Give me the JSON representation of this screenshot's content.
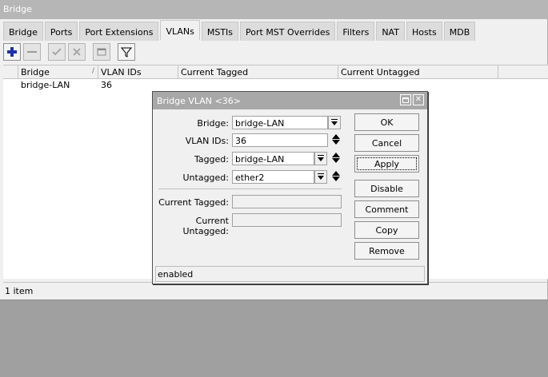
{
  "window": {
    "title": "Bridge"
  },
  "tabs": [
    {
      "label": "Bridge",
      "active": false
    },
    {
      "label": "Ports",
      "active": false
    },
    {
      "label": "Port Extensions",
      "active": false
    },
    {
      "label": "VLANs",
      "active": true
    },
    {
      "label": "MSTIs",
      "active": false
    },
    {
      "label": "Port MST Overrides",
      "active": false
    },
    {
      "label": "Filters",
      "active": false
    },
    {
      "label": "NAT",
      "active": false
    },
    {
      "label": "Hosts",
      "active": false
    },
    {
      "label": "MDB",
      "active": false
    }
  ],
  "toolbar": {
    "icons": [
      "add-icon",
      "remove-icon",
      "enable-icon",
      "disable-icon",
      "comment-icon",
      "filter-icon"
    ],
    "accent_color": "#1c2fb0"
  },
  "table": {
    "columns": [
      "",
      "Bridge",
      "VLAN IDs",
      "Current Tagged",
      "Current Untagged"
    ],
    "rows": [
      {
        "bridge": "bridge-LAN",
        "vlan_ids": "36",
        "current_tagged": "",
        "current_untagged": ""
      }
    ]
  },
  "status": {
    "item_count": "1 item"
  },
  "dialog": {
    "title": "Bridge VLAN <36>",
    "fields": {
      "bridge": {
        "label": "Bridge:",
        "value": "bridge-LAN"
      },
      "vlan_ids": {
        "label": "VLAN IDs:",
        "value": "36"
      },
      "tagged": {
        "label": "Tagged:",
        "value": "bridge-LAN"
      },
      "untagged": {
        "label": "Untagged:",
        "value": "ether2"
      },
      "current_tagged": {
        "label": "Current Tagged:",
        "value": ""
      },
      "current_untagged": {
        "label": "Current Untagged:",
        "value": ""
      }
    },
    "buttons": {
      "ok": "OK",
      "cancel": "Cancel",
      "apply": "Apply",
      "disable": "Disable",
      "comment": "Comment",
      "copy": "Copy",
      "remove": "Remove"
    },
    "status": "enabled"
  }
}
